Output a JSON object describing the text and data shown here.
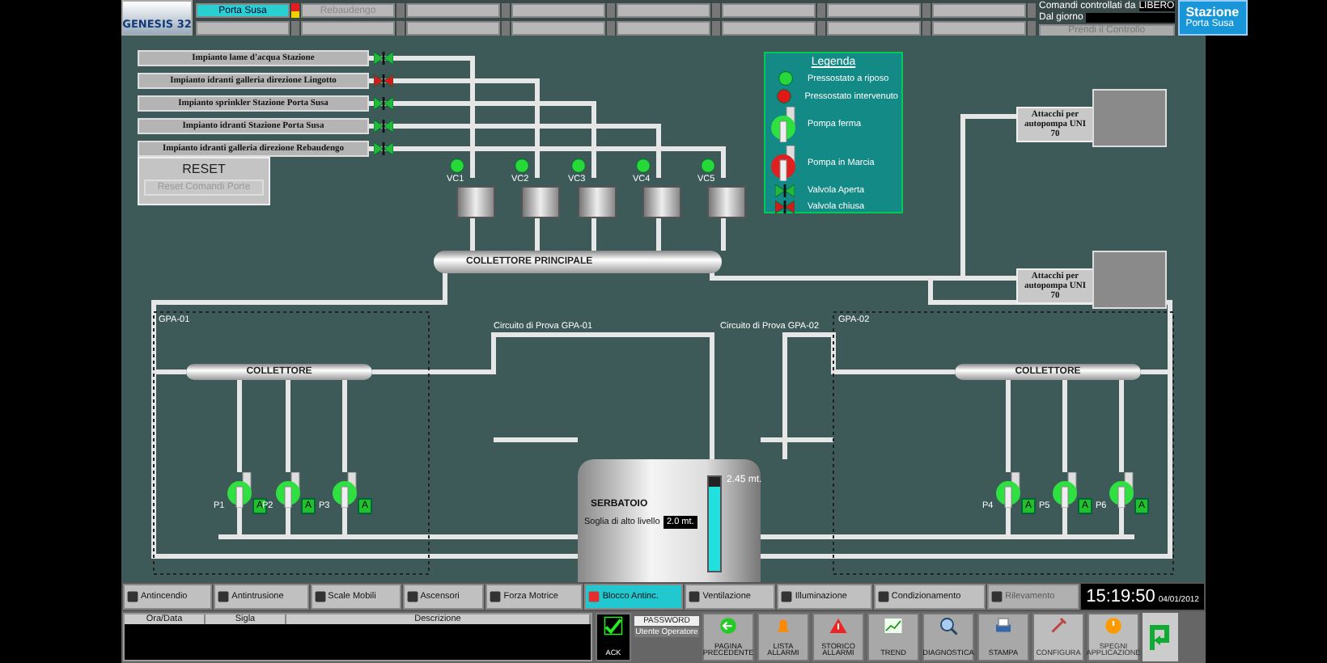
{
  "header": {
    "logo": "GENESIS 32",
    "stations": [
      {
        "label": "Porta Susa",
        "selected": true,
        "disabled": false
      },
      {
        "label": "Rebaudengo",
        "selected": false,
        "disabled": true
      }
    ],
    "control_label": "Comandi controllati da",
    "control_value": "LIBERO",
    "since_label": "Dal giorno",
    "take_control": {
      "label": "Prendi il Controllo",
      "disabled": true
    },
    "station_title": "Stazione",
    "station_name": "Porta Susa"
  },
  "plants": [
    {
      "label": "Impianto lame d'acqua Stazione",
      "valve_open": true
    },
    {
      "label": "Impianto idranti galleria direzione Lingotto",
      "valve_open": false
    },
    {
      "label": "Impianto sprinkler Stazione Porta Susa",
      "valve_open": true
    },
    {
      "label": "Impianto idranti Stazione Porta Susa",
      "valve_open": true
    },
    {
      "label": "Impianto idranti galleria direzione Rebaudengo",
      "valve_open": true
    }
  ],
  "reset": {
    "title": "RESET",
    "button": {
      "label": "Reset Comandi Porte",
      "disabled": true
    }
  },
  "manifold_pumps": [
    {
      "label": "VC1",
      "pressure_ok": true
    },
    {
      "label": "VC2",
      "pressure_ok": true
    },
    {
      "label": "VC3",
      "pressure_ok": true
    },
    {
      "label": "VC4",
      "pressure_ok": true
    },
    {
      "label": "VC5",
      "pressure_ok": true
    }
  ],
  "main_manifold": "COLLETTORE PRINCIPALE",
  "legend": {
    "title": "Legenda",
    "items": [
      {
        "kind": "pressure-idle",
        "label": "Pressostato a riposo"
      },
      {
        "kind": "pressure-tripped",
        "label": "Pressostato intervenuto"
      },
      {
        "kind": "pump-stopped",
        "label": "Pompa ferma"
      },
      {
        "kind": "pump-running",
        "label": "Pompa in Marcia"
      },
      {
        "kind": "valve-open",
        "label": "Valvola Aperta"
      },
      {
        "kind": "valve-closed",
        "label": "Valvola chiusa"
      }
    ]
  },
  "truck_connections": [
    {
      "label": "Attacchi per autopompa UNI 70"
    },
    {
      "label": "Attacchi per autopompa UNI 70"
    }
  ],
  "groups": [
    {
      "label": "GPA-01",
      "test_circuit": "Circuito di Prova GPA-01",
      "manifold": "COLLETTORE",
      "pumps": [
        {
          "label": "P1",
          "running": false,
          "mode": "A"
        },
        {
          "label": "P2",
          "running": false,
          "mode": "A"
        },
        {
          "label": "P3",
          "running": false,
          "mode": "A"
        }
      ]
    },
    {
      "label": "GPA-02",
      "test_circuit": "Circuito di Prova GPA-02",
      "manifold": "COLLETTORE",
      "pumps": [
        {
          "label": "P4",
          "running": false,
          "mode": "A"
        },
        {
          "label": "P5",
          "running": false,
          "mode": "A"
        },
        {
          "label": "P6",
          "running": false,
          "mode": "A"
        }
      ]
    }
  ],
  "tank": {
    "title": "SERBATOIO",
    "threshold_label": "Soglia di alto livello",
    "threshold_value": "2.0 mt.",
    "level": 0.9,
    "reading": "2.45 mt."
  },
  "systems": [
    {
      "label": "Antincendio",
      "selected": false,
      "disabled": false
    },
    {
      "label": "Antintrusione",
      "selected": false,
      "disabled": false
    },
    {
      "label": "Scale Mobili",
      "selected": false,
      "disabled": false
    },
    {
      "label": "Ascensori",
      "selected": false,
      "disabled": false
    },
    {
      "label": "Forza Motrice",
      "selected": false,
      "disabled": false
    },
    {
      "label": "Blocco Antinc.",
      "selected": true,
      "disabled": false
    },
    {
      "label": "Ventilazione",
      "selected": false,
      "disabled": false
    },
    {
      "label": "Illuminazione",
      "selected": false,
      "disabled": false
    },
    {
      "label": "Condizionamento",
      "selected": false,
      "disabled": false
    },
    {
      "label": "Rilevamento",
      "selected": false,
      "disabled": true
    }
  ],
  "clock": {
    "time": "15:19:50",
    "date": "04/01/2012"
  },
  "alarm_table": {
    "columns": [
      "Ora/Data",
      "Sigla",
      "Descrizione"
    ]
  },
  "password": {
    "label": "PASSWORD",
    "user": "Utente Operatore"
  },
  "actions": [
    {
      "kind": "ack",
      "label": "ACK",
      "disabled": false
    },
    {
      "kind": "back",
      "label": "PAGINA PRECEDENTE",
      "disabled": false
    },
    {
      "kind": "alarms",
      "label": "LISTA ALLARMI",
      "disabled": false
    },
    {
      "kind": "history",
      "label": "STORICO ALLARMI",
      "disabled": false
    },
    {
      "kind": "trend",
      "label": "TREND",
      "disabled": false
    },
    {
      "kind": "diagnostics",
      "label": "DIAGNOSTICA",
      "disabled": false
    },
    {
      "kind": "print",
      "label": "STAMPA",
      "disabled": false
    },
    {
      "kind": "configure",
      "label": "CONFIGURA",
      "disabled": true
    },
    {
      "kind": "shutdown",
      "label": "SPEGNI APPLICAZIONE",
      "disabled": true
    }
  ]
}
